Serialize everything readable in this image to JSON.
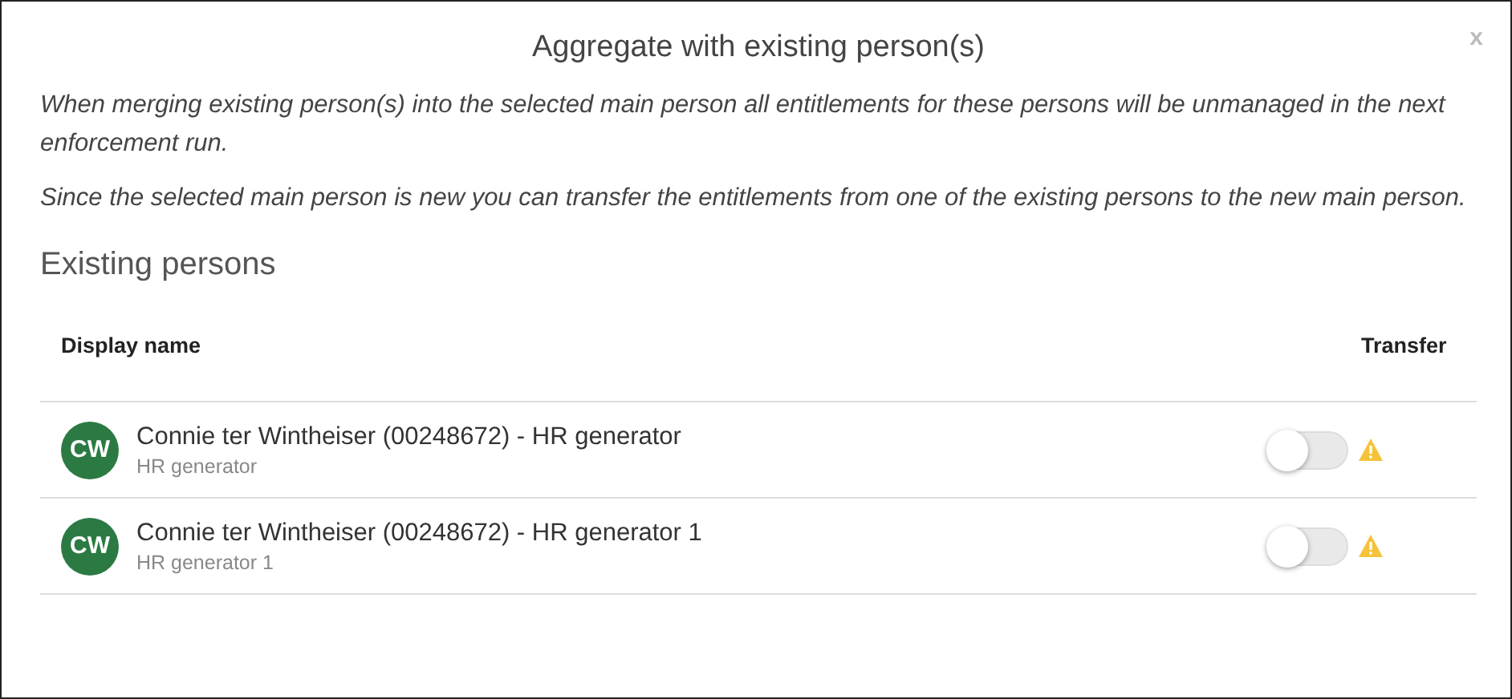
{
  "dialog": {
    "title": "Aggregate with existing person(s)",
    "close": "x",
    "paragraphs": [
      "When merging existing person(s) into the selected main person all entitlements for these persons will be unmanaged in the next enforcement run.",
      "Since the selected main person is new you can transfer the entitlements from one of the existing persons to the new main person."
    ],
    "section_title": "Existing persons",
    "table": {
      "columns": [
        "Display name",
        "Transfer"
      ],
      "rows": [
        {
          "initials": "CW",
          "name": "Connie ter Wintheiser (00248672) - HR generator",
          "subtitle": "HR generator",
          "transfer": {
            "on": false
          }
        },
        {
          "initials": "CW",
          "name": "Connie ter Wintheiser (00248672) - HR generator 1",
          "subtitle": "HR generator 1",
          "transfer": {
            "on": false
          }
        }
      ]
    }
  }
}
